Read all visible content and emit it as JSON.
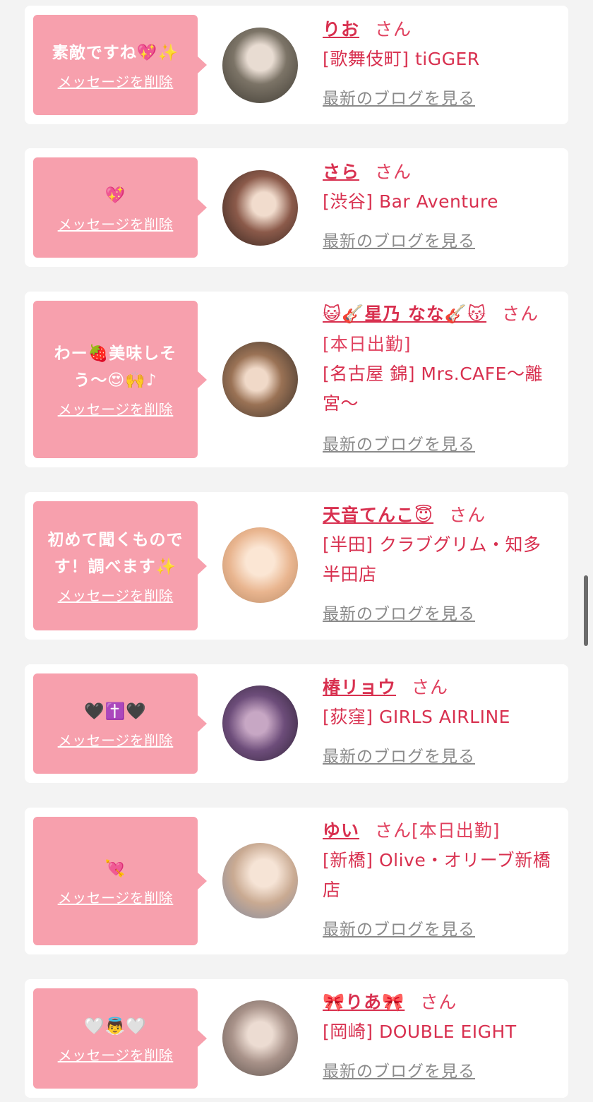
{
  "entries": [
    {
      "message": "素敵ですね💖✨",
      "delete_label": "メッセージを削除",
      "name": "りお",
      "suffix": "さん",
      "shop": "[歌舞伎町] tiGGER",
      "blog_label": "最新のブログを見る"
    },
    {
      "message": "💖",
      "delete_label": "メッセージを削除",
      "name": "さら",
      "suffix": "さん",
      "shop": "[渋谷] Bar Aventure",
      "blog_label": "最新のブログを見る"
    },
    {
      "message": "わー🍓美味しそう〜😍🙌♪",
      "delete_label": "メッセージを削除",
      "name": "😺🎸星乃 なな🎸😽",
      "suffix": "さん[本日出勤]",
      "shop": "[名古屋 錦] Mrs.CAFE〜離宮〜",
      "blog_label": "最新のブログを見る"
    },
    {
      "message": "初めて聞くものです！調べます✨",
      "delete_label": "メッセージを削除",
      "name": "天音てんこ😇",
      "suffix": "さん",
      "shop": "[半田] クラブグリム・知多半田店",
      "blog_label": "最新のブログを見る"
    },
    {
      "message": "🖤✝️🖤",
      "delete_label": "メッセージを削除",
      "name": "椿リョウ",
      "suffix": "さん",
      "shop": "[荻窪] GIRLS AIRLINE",
      "blog_label": "最新のブログを見る"
    },
    {
      "message": "💘",
      "delete_label": "メッセージを削除",
      "name": "ゆい",
      "suffix": "さん[本日出勤]",
      "shop": "[新橋] Olive・オリーブ新橋店",
      "blog_label": "最新のブログを見る"
    },
    {
      "message": "🤍👼🤍",
      "delete_label": "メッセージを削除",
      "name": "🎀りあ🎀",
      "suffix": "さん",
      "shop": "[岡崎] DOUBLE EIGHT",
      "blog_label": "最新のブログを見る"
    }
  ]
}
